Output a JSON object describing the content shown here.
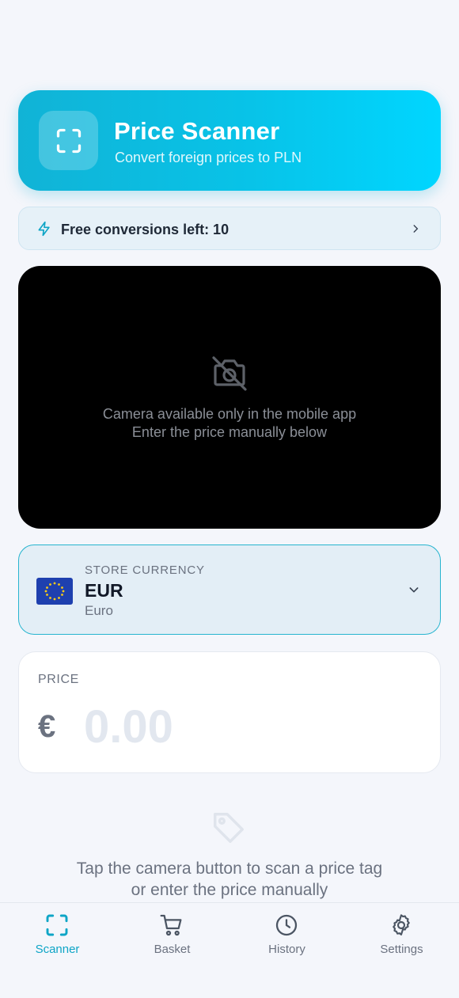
{
  "header": {
    "title": "Price Scanner",
    "subtitle": "Convert foreign prices to PLN",
    "icon": "scan-frame-icon"
  },
  "free_conversions": {
    "label": "Free conversions left: 10",
    "icon": "lightning-icon"
  },
  "camera": {
    "icon": "camera-off-icon",
    "message_line1": "Camera available only in the mobile app",
    "message_line2": "Enter the price manually below"
  },
  "currency": {
    "label": "STORE CURRENCY",
    "code": "EUR",
    "name": "Euro",
    "flag": "eu-flag-icon"
  },
  "price": {
    "label": "PRICE",
    "symbol": "€",
    "value": "",
    "placeholder": "0.00"
  },
  "hint": {
    "icon": "price-tag-icon",
    "line1": "Tap the camera button to scan a price tag",
    "line2": "or enter the price manually"
  },
  "nav": {
    "items": [
      {
        "label": "Scanner",
        "icon": "scan-frame-icon",
        "active": true
      },
      {
        "label": "Basket",
        "icon": "cart-icon",
        "active": false
      },
      {
        "label": "History",
        "icon": "clock-icon",
        "active": false
      },
      {
        "label": "Settings",
        "icon": "gear-icon",
        "active": false
      }
    ]
  },
  "colors": {
    "accent": "#0ea5c6",
    "hero_start": "#11b3d6",
    "hero_end": "#00d6ff",
    "background": "#f4f6fb"
  }
}
